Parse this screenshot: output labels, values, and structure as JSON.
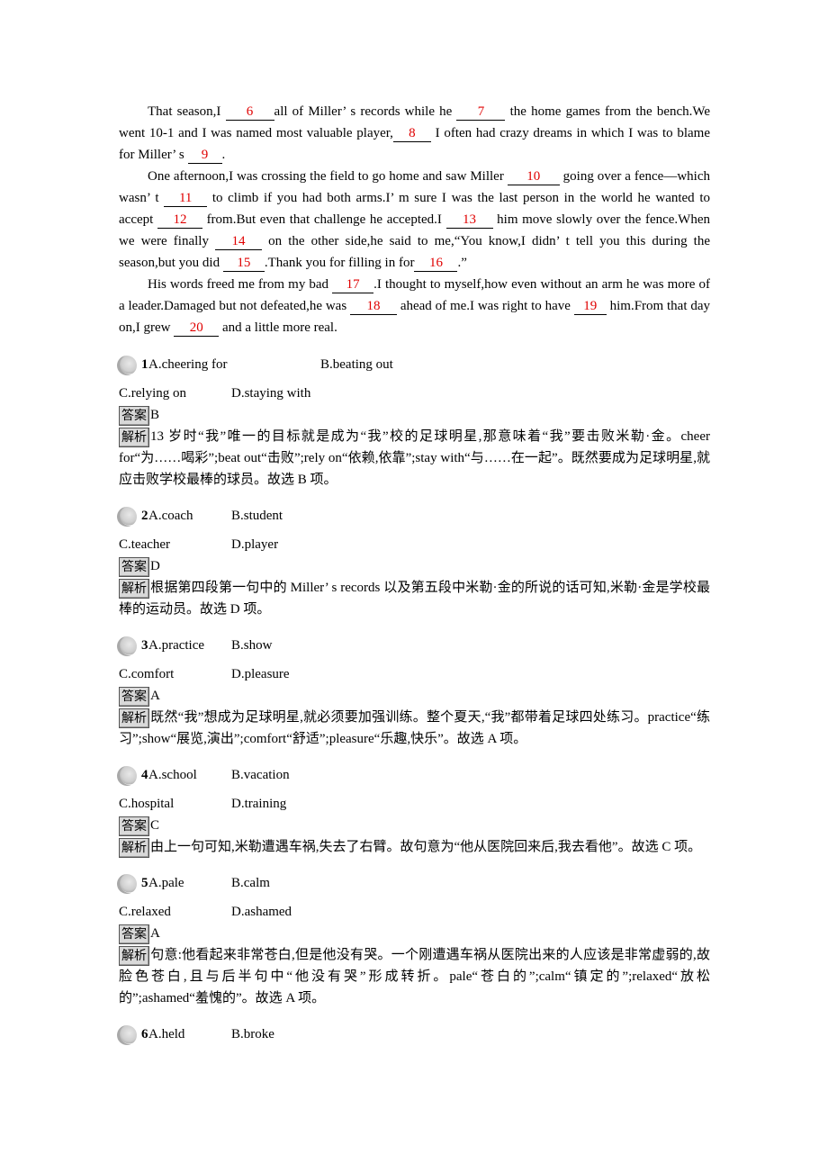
{
  "passage": {
    "paragraphs": [
      [
        {
          "t": "That season,I "
        },
        {
          "blank": "6"
        },
        {
          "t": "all of Miller’ s records while he "
        },
        {
          "blank": "7"
        },
        {
          "t": " the home games from the bench.We went 10-1 and I was named most valuable player,"
        },
        {
          "blank": "8"
        },
        {
          "t": " I often had crazy dreams in which I was to blame for Miller’ s "
        },
        {
          "blank": "9"
        },
        {
          "t": "."
        }
      ],
      [
        {
          "t": "One afternoon,I was crossing the field to go home and saw Miller "
        },
        {
          "blank": "10"
        },
        {
          "t": " going over a fence—which wasn’ t "
        },
        {
          "blank": "11"
        },
        {
          "t": " to climb if you had both arms.I’ m sure I was the last person in the world he wanted to accept "
        },
        {
          "blank": "12"
        },
        {
          "t": " from.But even that challenge he accepted.I "
        },
        {
          "blank": "13"
        },
        {
          "t": " him move slowly over the fence.When we were finally "
        },
        {
          "blank": "14"
        },
        {
          "t": " on the other side,he said to me,“You know,I didn’ t tell you this during the season,but you did "
        },
        {
          "blank": "15"
        },
        {
          "t": ".Thank you for filling in for"
        },
        {
          "blank": "16"
        },
        {
          "t": ".”"
        }
      ],
      [
        {
          "t": "His words freed me from my bad "
        },
        {
          "blank": "17"
        },
        {
          "t": ".I thought to myself,how even without an arm he was more of a leader.Damaged but not defeated,he was "
        },
        {
          "blank": "18"
        },
        {
          "t": " ahead of me.I was right to have "
        },
        {
          "blank": "19"
        },
        {
          "t": " him.From that day on,I grew "
        },
        {
          "blank": "20"
        },
        {
          "t": " and a little more real."
        }
      ]
    ]
  },
  "labels": {
    "answer_tag": "答案",
    "explanation_tag": "解析"
  },
  "questions": [
    {
      "number": "1",
      "options": {
        "A": "A.cheering for",
        "B": "B.beating out",
        "C": "C.relying on",
        "D": "D.staying with"
      },
      "answer": "B",
      "explanation": "13 岁时“我”唯一的目标就是成为“我”校的足球明星,那意味着“我”要击败米勒·金。cheer for“为……喝彩”;beat out“击败”;rely on“依赖,依靠”;stay with“与……在一起”。既然要成为足球明星,就应击败学校最棒的球员。故选 B 项。"
    },
    {
      "number": "2",
      "options": {
        "A": "A.coach",
        "B": "B.student",
        "C": "C.teacher",
        "D": "D.player"
      },
      "answer": "D",
      "explanation": "根据第四段第一句中的 Miller’ s records 以及第五段中米勒·金的所说的话可知,米勒·金是学校最棒的运动员。故选 D 项。"
    },
    {
      "number": "3",
      "options": {
        "A": "A.practice",
        "B": "B.show",
        "C": "C.comfort",
        "D": "D.pleasure"
      },
      "answer": "A",
      "explanation": "既然“我”想成为足球明星,就必须要加强训练。整个夏天,“我”都带着足球四处练习。practice“练习”;show“展览,演出”;comfort“舒适”;pleasure“乐趣,快乐”。故选 A 项。"
    },
    {
      "number": "4",
      "options": {
        "A": "A.school",
        "B": "B.vacation",
        "C": "C.hospital",
        "D": "D.training"
      },
      "answer": "C",
      "explanation": "由上一句可知,米勒遭遇车祸,失去了右臂。故句意为“他从医院回来后,我去看他”。故选 C 项。"
    },
    {
      "number": "5",
      "options": {
        "A": "A.pale",
        "B": "B.calm",
        "C": "C.relaxed",
        "D": "D.ashamed"
      },
      "answer": "A",
      "explanation": "句意:他看起来非常苍白,但是他没有哭。一个刚遭遇车祸从医院出来的人应该是非常虚弱的,故脸色苍白,且与后半句中“他没有哭”形成转折。pale“苍白的”;calm“镇定的”;relaxed“放松的”;ashamed“羞愧的”。故选 A 项。"
    },
    {
      "number": "6",
      "options": {
        "A": "A.held",
        "B": "B.broke"
      },
      "answer": null,
      "explanation": null
    }
  ],
  "colors": {
    "blank_number": "#e00000",
    "tag_background": "#d9d9d9",
    "text": "#000000"
  }
}
